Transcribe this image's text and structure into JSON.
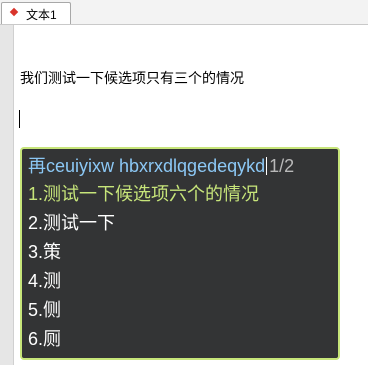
{
  "tab": {
    "label": "文本1",
    "icon": "diamond-icon"
  },
  "editor": {
    "line1": "我们测试一下候选项只有三个的情况"
  },
  "ime": {
    "composition": "再ceuiyixw hbxrxdlqgedeqykd",
    "page": "1/2",
    "candidates": [
      {
        "num": "1.",
        "text": "测试一下候选项六个的情况"
      },
      {
        "num": "2.",
        "text": "测试一下"
      },
      {
        "num": "3.",
        "text": "策"
      },
      {
        "num": "4.",
        "text": "测"
      },
      {
        "num": "5.",
        "text": "侧"
      },
      {
        "num": "6.",
        "text": "厕"
      }
    ],
    "colors": {
      "background": "#333435",
      "border": "#c7e57a",
      "composition": "#8cc8f5",
      "selected": "#c7e57a"
    }
  }
}
